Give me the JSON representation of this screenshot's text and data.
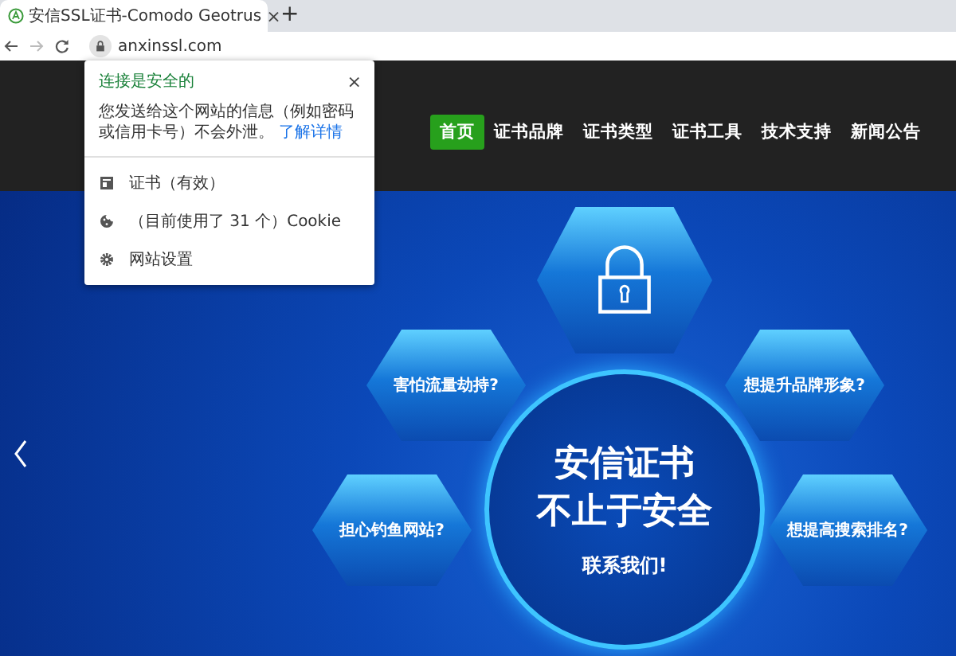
{
  "browser": {
    "tab": {
      "title": "安信SSL证书-Comodo Geotrus",
      "close": "×"
    },
    "new_tab": "+",
    "address": "anxinssl.com"
  },
  "site_popup": {
    "title": "连接是安全的",
    "close": "×",
    "message": "您发送给这个网站的信息（例如密码或信用卡号）不会外泄。",
    "link": "了解详情",
    "items": [
      {
        "kind": "certificate",
        "label": "证书（有效）"
      },
      {
        "kind": "cookie",
        "label": "（目前使用了 31 个）Cookie"
      },
      {
        "kind": "settings",
        "label": "网站设置"
      }
    ]
  },
  "nav": {
    "items": [
      {
        "label": "首页",
        "selected": true
      },
      {
        "label": "证书品牌",
        "selected": false
      },
      {
        "label": "证书类型",
        "selected": false
      },
      {
        "label": "证书工具",
        "selected": false
      },
      {
        "label": "技术支持",
        "selected": false
      },
      {
        "label": "新闻公告",
        "selected": false
      }
    ]
  },
  "banner": {
    "questions": [
      "害怕流量劫持?",
      "想提升品牌形象?",
      "担心钓鱼网站?",
      "想提高搜索排名?"
    ],
    "headline": [
      "安信证书",
      "不止于安全"
    ],
    "cta": "联系我们!"
  }
}
